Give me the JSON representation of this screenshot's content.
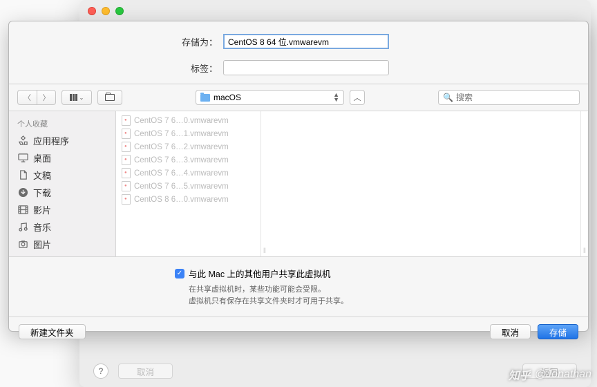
{
  "saveAs": {
    "label": "存储为：",
    "value": "CentOS 8 64 位.vmwarevm"
  },
  "tags": {
    "label": "标签："
  },
  "location": {
    "selected": "macOS"
  },
  "search": {
    "placeholder": "搜索"
  },
  "sidebar": {
    "header": "个人收藏",
    "items": [
      {
        "label": "应用程序"
      },
      {
        "label": "桌面"
      },
      {
        "label": "文稿"
      },
      {
        "label": "下载"
      },
      {
        "label": "影片"
      },
      {
        "label": "音乐"
      },
      {
        "label": "图片"
      }
    ]
  },
  "files": [
    "CentOS 7 6…0.vmwarevm",
    "CentOS 7 6…1.vmwarevm",
    "CentOS 7 6…2.vmwarevm",
    "CentOS 7 6…3.vmwarevm",
    "CentOS 7 6…4.vmwarevm",
    "CentOS 7 6…5.vmwarevm",
    "CentOS 8 6…0.vmwarevm"
  ],
  "share": {
    "checkboxLabel": "与此 Mac 上的其他用户共享此虚拟机",
    "hint1": "在共享虚拟机时，某些功能可能会受限。",
    "hint2": "虚拟机只有保存在共享文件夹时才可用于共享。"
  },
  "buttons": {
    "newFolder": "新建文件夹",
    "cancel": "取消",
    "save": "存储",
    "back": "返回",
    "cancelOuter": "取消"
  },
  "watermark": {
    "brand": "知乎",
    "author": "@Jonathan"
  }
}
